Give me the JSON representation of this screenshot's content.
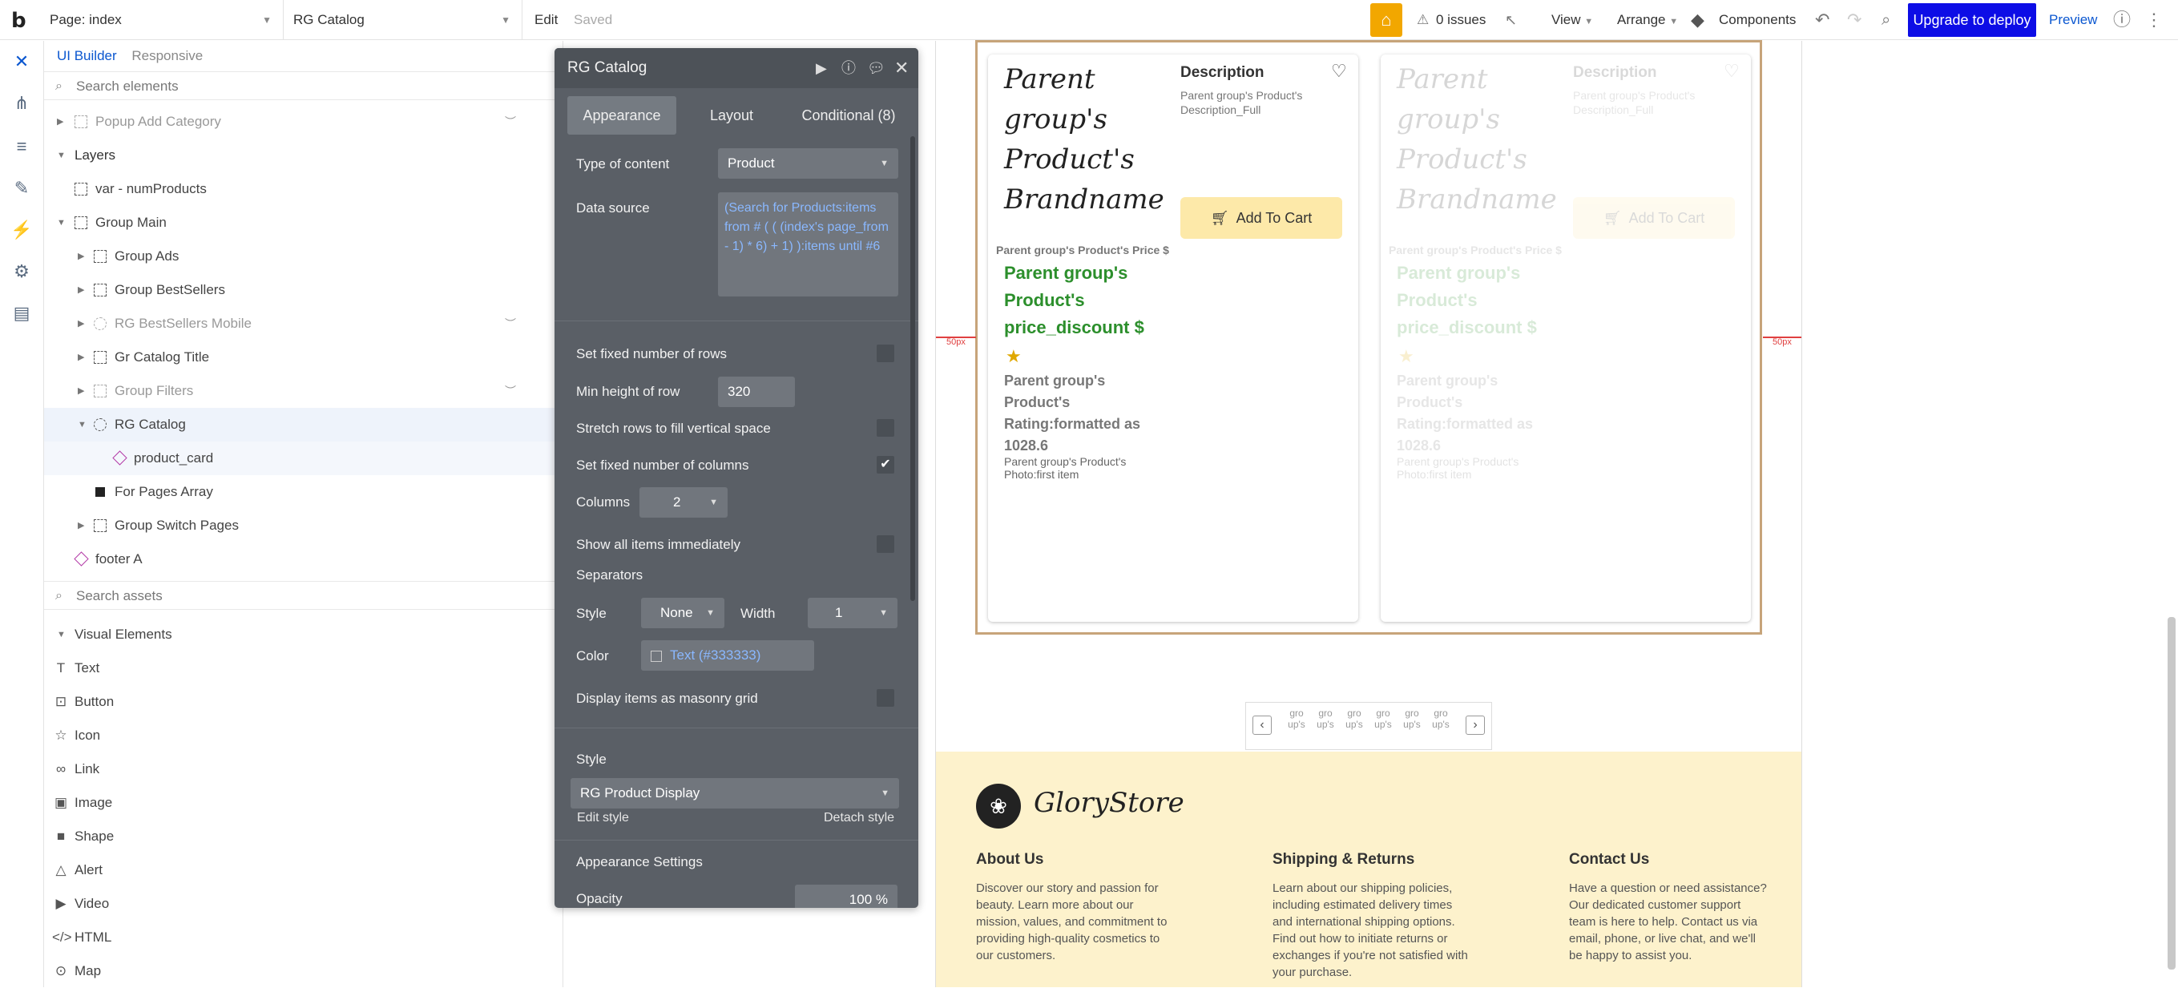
{
  "topbar": {
    "logo": "b",
    "page_select": "Page: index",
    "element_select": "RG Catalog",
    "edit": "Edit",
    "saved": "Saved",
    "issues": "0 issues",
    "view": "View",
    "arrange": "Arrange",
    "components": "Components",
    "deploy": "Upgrade to deploy",
    "preview": "Preview"
  },
  "left_panel": {
    "tab_builder": "UI Builder",
    "tab_responsive": "Responsive",
    "search_elements": "Search elements",
    "tree": [
      {
        "label": "Popup Add Category"
      },
      {
        "label": "Layers"
      },
      {
        "label": "var - numProducts"
      },
      {
        "label": "Group Main"
      },
      {
        "label": "Group Ads"
      },
      {
        "label": "Group BestSellers"
      },
      {
        "label": "RG BestSellers Mobile"
      },
      {
        "label": "Gr Catalog Title"
      },
      {
        "label": "Group Filters"
      },
      {
        "label": "RG Catalog"
      },
      {
        "label": "product_card"
      },
      {
        "label": "For Pages Array"
      },
      {
        "label": "Group Switch Pages"
      },
      {
        "label": "footer A"
      }
    ],
    "search_assets": "Search assets",
    "visual_elements_title": "Visual Elements",
    "visual_elements": [
      {
        "label": "Text",
        "icon": "text-icon"
      },
      {
        "label": "Button",
        "icon": "button-icon"
      },
      {
        "label": "Icon",
        "icon": "star-icon"
      },
      {
        "label": "Link",
        "icon": "link-icon"
      },
      {
        "label": "Image",
        "icon": "image-icon"
      },
      {
        "label": "Shape",
        "icon": "shape-icon"
      },
      {
        "label": "Alert",
        "icon": "alert-icon"
      },
      {
        "label": "Video",
        "icon": "video-icon"
      },
      {
        "label": "HTML",
        "icon": "code-icon"
      },
      {
        "label": "Map",
        "icon": "map-pin-icon"
      }
    ]
  },
  "editor": {
    "title": "RG Catalog",
    "tabs": [
      "Appearance",
      "Layout",
      "Conditional (8)"
    ],
    "type_of_content_label": "Type of content",
    "type_of_content_value": "Product",
    "data_source_label": "Data source",
    "data_source_value": "(Search for Products:items from # ( ( (index's page_from - 1) * 6) + 1) ):items until #6",
    "fixed_rows_label": "Set fixed number of rows",
    "min_height_label": "Min height of row",
    "min_height_value": "320",
    "stretch_label": "Stretch rows to fill vertical space",
    "fixed_cols_label": "Set fixed number of columns",
    "columns_label": "Columns",
    "columns_value": "2",
    "show_all_label": "Show all items immediately",
    "separators_label": "Separators",
    "style_label": "Style",
    "style_value": "None",
    "width_label": "Width",
    "width_value": "1",
    "color_label": "Color",
    "color_value": "Text (#333333)",
    "masonry_label": "Display items as masonry grid",
    "style_section_label": "Style",
    "style_select_value": "RG Product Display",
    "edit_style": "Edit style",
    "detach_style": "Detach style",
    "appearance_settings": "Appearance Settings",
    "opacity_label": "Opacity",
    "opacity_value": "100 %"
  },
  "canvas": {
    "card": {
      "brand": "Parent group's Product's Brandname",
      "desc_title": "Description",
      "desc_value": "Parent group's Product's Description_Full",
      "add_to_cart": "Add To Cart",
      "price_label": "Parent group's Product's Price $",
      "price_value": "Parent group's Product's price_discount $",
      "rating": "Parent group's Product's Rating:formatted as 1028.6",
      "photo": "Parent group's Product's Photo:first item"
    },
    "spacing_label": "50px",
    "pager_pages": [
      "gro up's",
      "gro up's",
      "gro up's",
      "gro up's",
      "gro up's",
      "gro up's"
    ],
    "footer": {
      "brand": "GloryStore",
      "about_title": "About Us",
      "about_text": "Discover our story and passion for beauty. Learn more about our mission, values, and commitment to providing high-quality cosmetics to our customers.",
      "ship_title": "Shipping & Returns",
      "ship_text": "Learn about our shipping policies, including estimated delivery times and international shipping options. Find out how to initiate returns or exchanges if you're not satisfied with your purchase.",
      "contact_title": "Contact Us",
      "contact_text": "Have a question or need assistance? Our dedicated customer support team is here to help. Contact us via email, phone, or live chat, and we'll be happy to assist you."
    }
  },
  "colors": {
    "accent_blue": "#0b57d0",
    "deploy_button": "#0d0de6",
    "gift_button": "#f2a700",
    "editor_bg": "#5a5f66",
    "price_green": "#2c8f2c",
    "add_to_cart_bg": "#fde9a9",
    "footer_bg": "#fdf2cc",
    "repeating_group_border": "#c7a47a"
  }
}
